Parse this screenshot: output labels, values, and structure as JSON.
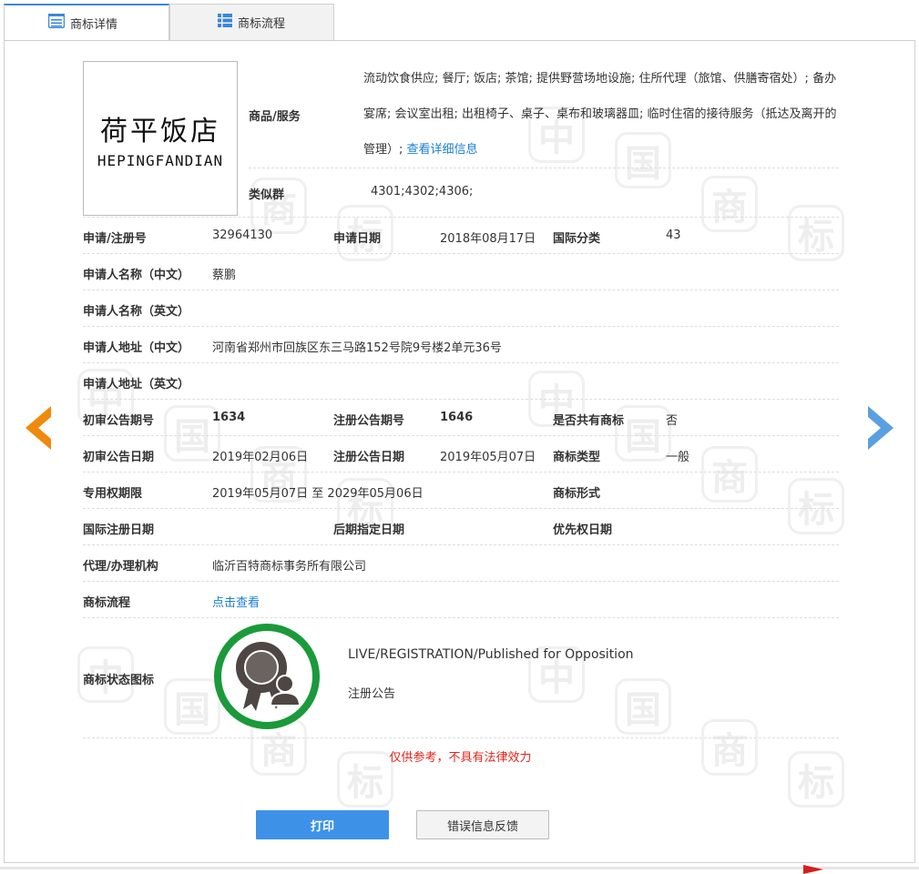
{
  "tabs": [
    {
      "label": "商标详情",
      "icon": "list-detail-icon",
      "active": true
    },
    {
      "label": "商标流程",
      "icon": "grid-list-icon",
      "active": false
    }
  ],
  "trademark_image": {
    "cn": "荷平饭店",
    "en": "HEPINGFANDIAN"
  },
  "goods": {
    "label": "商品/服务",
    "text": "流动饮食供应; 餐厅; 饭店; 茶馆; 提供野营场地设施; 住所代理（旅馆、供膳寄宿处）; 备办宴席; 会议室出租; 出租椅子、桌子、桌布和玻璃器皿; 临时住宿的接待服务（抵达及离开的管理）;",
    "more_link": "查看详细信息"
  },
  "similar_group": {
    "label": "类似群",
    "value": "4301;4302;4306;"
  },
  "fields": {
    "reg_no_label": "申请/注册号",
    "reg_no": "32964130",
    "app_date_label": "申请日期",
    "app_date": "2018年08月17日",
    "intl_class_label": "国际分类",
    "intl_class": "43",
    "applicant_cn_label": "申请人名称（中文）",
    "applicant_cn": "蔡鹏",
    "applicant_en_label": "申请人名称（英文）",
    "applicant_en": "",
    "address_cn_label": "申请人地址（中文）",
    "address_cn": "河南省郑州市回族区东三马路152号院9号楼2单元36号",
    "address_en_label": "申请人地址（英文）",
    "address_en": "",
    "prelim_no_label": "初审公告期号",
    "prelim_no": "1634",
    "reg_pub_no_label": "注册公告期号",
    "reg_pub_no": "1646",
    "shared_label": "是否共有商标",
    "shared": "否",
    "prelim_date_label": "初审公告日期",
    "prelim_date": "2019年02月06日",
    "reg_pub_date_label": "注册公告日期",
    "reg_pub_date": "2019年05月07日",
    "tm_type_label": "商标类型",
    "tm_type": "一般",
    "exclusive_label": "专用权期限",
    "exclusive": "2019年05月07日 至 2029年05月06日",
    "tm_form_label": "商标形式",
    "tm_form": "",
    "intl_reg_date_label": "国际注册日期",
    "intl_reg_date": "",
    "later_date_label": "后期指定日期",
    "later_date": "",
    "priority_date_label": "优先权日期",
    "priority_date": "",
    "agent_label": "代理/办理机构",
    "agent": "临沂百特商标事务所有限公司",
    "flow_label": "商标流程",
    "flow_link": "点击查看",
    "status_label": "商标状态图标",
    "status_en": "LIVE/REGISTRATION/Published for Opposition",
    "status_cn": "注册公告"
  },
  "disclaimer": "仅供参考，不具有法律效力",
  "buttons": {
    "print": "打印",
    "feedback": "错误信息反馈"
  },
  "colors": {
    "accent": "#3d92e8",
    "link": "#1a7fd1",
    "warning": "#e0251c",
    "status_ring": "#1a9a3a",
    "prev_arrow": "#f08a0c",
    "next_arrow": "#5aa0e0"
  },
  "watermark": {
    "chars": [
      "中",
      "国",
      "商",
      "标"
    ]
  }
}
